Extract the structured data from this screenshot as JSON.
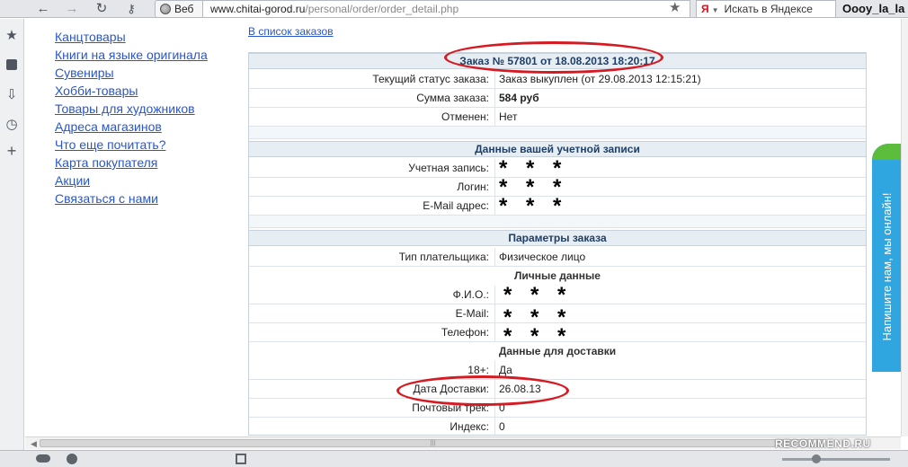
{
  "toolbar": {
    "site_label": "Веб",
    "url_host": "www.chitai-gorod.ru",
    "url_path": "/personal/order/order_detail.php",
    "search_engine_icon": "Я",
    "search_placeholder": "Искать в Яндексе",
    "user_name": "Oooy_la_la"
  },
  "menu": {
    "items": [
      "Канцтовары",
      "Книги на языке оригинала",
      "Сувениры",
      "Хобби-товары",
      "Товары для художников",
      "Адреса магазинов",
      "Что еще почитать?",
      "Карта покупателя",
      "Акции",
      "Связаться с нами"
    ]
  },
  "back_link": "В список заказов",
  "order": {
    "header": "Заказ № 57801 от 18.08.2013 18:20:17",
    "status_label": "Текущий статус заказа:",
    "status_value": "Заказ выкуплен (от 29.08.2013 12:15:21)",
    "sum_label": "Сумма заказа:",
    "sum_value": "584 руб",
    "cancelled_label": "Отменен:",
    "cancelled_value": "Нет"
  },
  "account": {
    "header": "Данные вашей учетной записи",
    "account_label": "Учетная запись:",
    "login_label": "Логин:",
    "email_label": "E-Mail адрес:",
    "masked": "* * *"
  },
  "params": {
    "header": "Параметры заказа",
    "payer_label": "Тип плательщика:",
    "payer_value": "Физическое лицо",
    "personal_header": "Личные данные",
    "fio_label": "Ф.И.О.:",
    "email_label": "E-Mail:",
    "phone_label": "Телефон:",
    "masked": "* * *",
    "delivery_header": "Данные для доставки",
    "age_label": "18+:",
    "age_value": "Да",
    "delivery_date_label": "Дата Доставки:",
    "delivery_date_value": "26.08.13",
    "track_label": "Почтовый трек:",
    "track_value": "0",
    "index_label": "Индекс:",
    "index_value": "0"
  },
  "chat": {
    "label": "Напишите нам, мы онлайн!"
  },
  "watermark": "RECOMMEND.RU",
  "colors": {
    "link": "#2a56c6",
    "section_bg": "#e6edf3",
    "mark": "#d61a22",
    "chat": "#2fa6df"
  }
}
